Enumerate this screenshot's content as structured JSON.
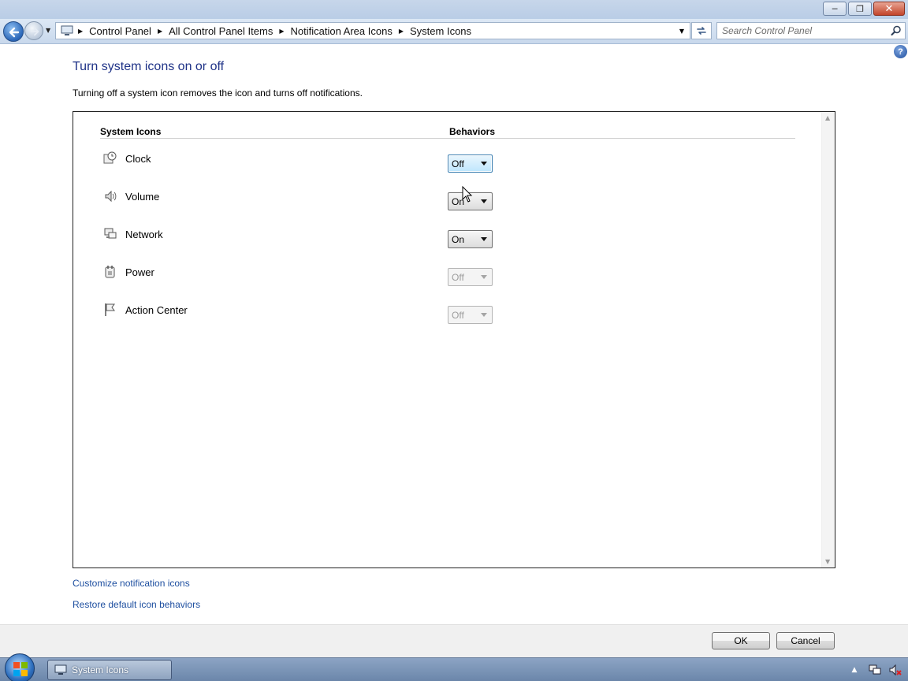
{
  "window": {
    "caption_buttons": {
      "minimize": "minimize-icon",
      "restore": "restore-icon",
      "close": "close-icon"
    }
  },
  "navbar": {
    "breadcrumbs": [
      "Control Panel",
      "All Control Panel Items",
      "Notification Area Icons",
      "System Icons"
    ],
    "search_placeholder": "Search Control Panel"
  },
  "main": {
    "title": "Turn system icons on or off",
    "description": "Turning off a system icon removes the icon and turns off notifications.",
    "col_icons": "System Icons",
    "col_behaviors": "Behaviors",
    "rows": [
      {
        "label": "Clock",
        "icon": "clock-icon",
        "value": "Off",
        "state": "focused"
      },
      {
        "label": "Volume",
        "icon": "volume-icon",
        "value": "On",
        "state": "normal"
      },
      {
        "label": "Network",
        "icon": "network-icon",
        "value": "On",
        "state": "normal"
      },
      {
        "label": "Power",
        "icon": "power-icon",
        "value": "Off",
        "state": "disabled"
      },
      {
        "label": "Action Center",
        "icon": "flag-icon",
        "value": "Off",
        "state": "disabled"
      }
    ]
  },
  "links": {
    "customize": "Customize notification icons",
    "restore": "Restore default icon behaviors"
  },
  "footer": {
    "ok": "OK",
    "cancel": "Cancel"
  },
  "taskbar": {
    "window_button": "System Icons"
  }
}
